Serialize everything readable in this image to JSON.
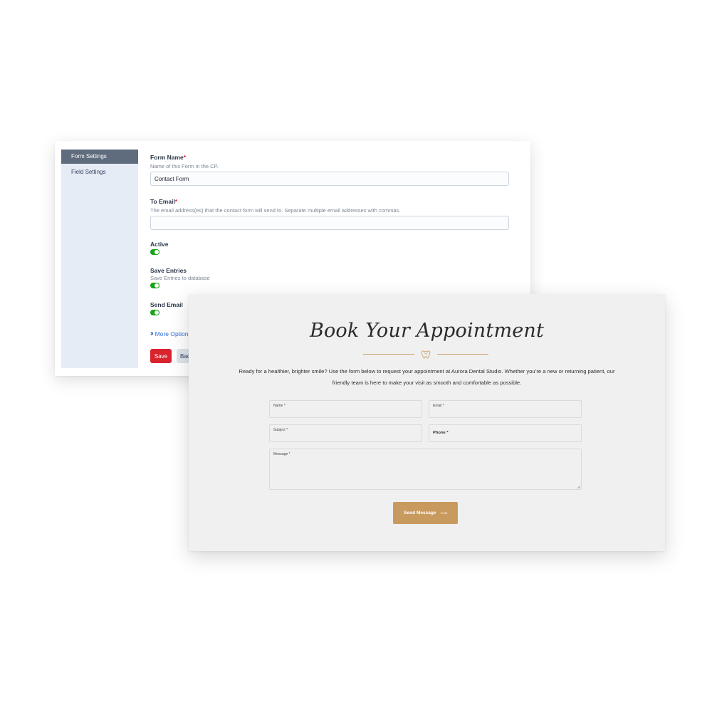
{
  "admin": {
    "sidebar": {
      "items": [
        {
          "label": "Form Settings",
          "active": true
        },
        {
          "label": "Field Settings",
          "active": false
        }
      ]
    },
    "form_name": {
      "label": "Form Name",
      "required_mark": "*",
      "help": "Name of this Form in the CP.",
      "value": "Contact Form"
    },
    "to_email": {
      "label": "To Email",
      "required_mark": "*",
      "help": "The email address(es) that the contact form will send to. Separate multiple email addresses with commas.",
      "value": ""
    },
    "active": {
      "label": "Active",
      "on": true
    },
    "save_entries": {
      "label": "Save Entries",
      "help": "Save Entries to database",
      "on": true
    },
    "send_email": {
      "label": "Send Email",
      "on": true
    },
    "more_options_label": "More Options",
    "save_label": "Save",
    "back_label": "Back",
    "colors": {
      "active_sidebar": "#5f6c7d",
      "sidebar_bg": "#e5ecf6",
      "toggle_on": "#17a317",
      "save_button": "#d9232d",
      "link": "#2e6bd9",
      "required": "#d9232d"
    },
    "icons": {
      "more_options": "double-chevron-right-icon"
    }
  },
  "booking": {
    "title": "Book Your Appointment",
    "intro": "Ready for a healthier, brighter smile? Use the form below to request your appointment at Aurora Dental Studio. Whether you’re a new or returning patient, our friendly team is here to make your visit as smooth and comfortable as possible.",
    "fields": {
      "name": "Name *",
      "email": "Email *",
      "subject": "Subject *",
      "phone": "Phone *",
      "message": "Message *"
    },
    "send_label": "Send Message",
    "send_arrow": "⟶",
    "colors": {
      "accent": "#c99a5e",
      "card_bg": "#f0f0f0"
    },
    "icons": {
      "divider": "tooth-icon",
      "send": "arrow-right-icon"
    }
  }
}
